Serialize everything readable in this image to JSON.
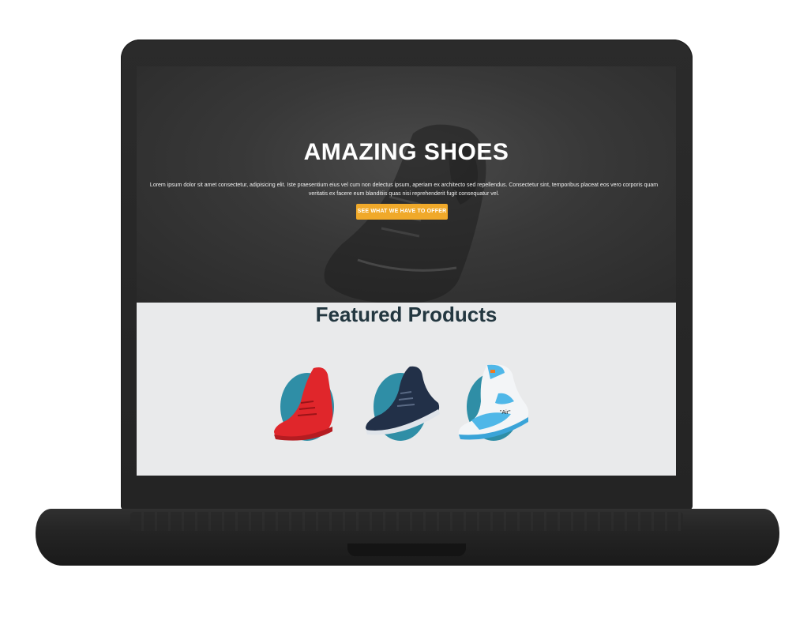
{
  "hero": {
    "title": "AMAZING SHOES",
    "text": "Lorem ipsum dolor sit amet consectetur, adipisicing elit. Iste praesentium eius vel cum non delectus ipsum, aperiam ex architecto sed repellendus. Consectetur sint, temporibus placeat eos vero corporis quam veritatis ex facere eum blanditiis quas nisi reprehenderit fugit consequatur vel.",
    "button_label": "SEE WHAT WE HAVE TO OFFER"
  },
  "featured": {
    "title": "Featured Products",
    "products": [
      {
        "color": "#e0262b",
        "icon": "red-sneaker-icon"
      },
      {
        "color": "#223048",
        "icon": "navy-sneaker-icon"
      },
      {
        "color": "#4fb7e8",
        "icon": "blue-white-sneaker-icon"
      }
    ]
  },
  "colors": {
    "accent": "#f0a92a",
    "circle": "#2f8ea6",
    "title_dark": "#233740"
  }
}
